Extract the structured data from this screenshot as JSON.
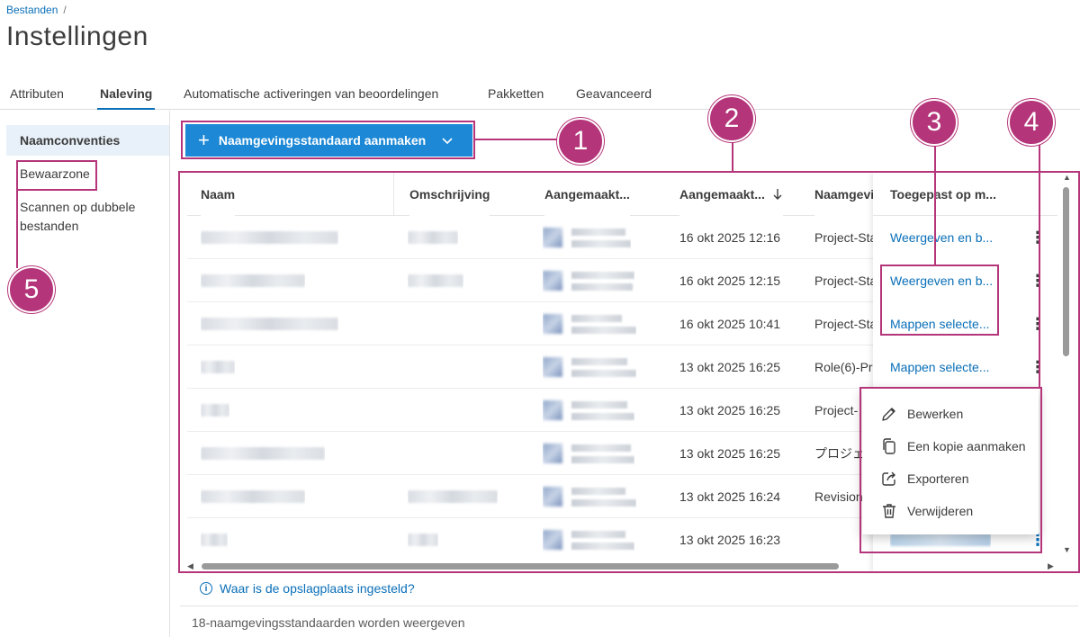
{
  "breadcrumb": {
    "root": "Bestanden",
    "separator": "/"
  },
  "page_title": "Instellingen",
  "tabs": [
    {
      "label": "Attributen",
      "active": false
    },
    {
      "label": "Naleving",
      "active": true
    },
    {
      "label": "Automatische activeringen van beoordelingen",
      "active": false
    },
    {
      "label": "Pakketten",
      "active": false
    },
    {
      "label": "Geavanceerd",
      "active": false
    }
  ],
  "sidebar": {
    "items": [
      {
        "label": "Naamconventies"
      },
      {
        "label": "Bewaarzone"
      },
      {
        "label": "Scannen op dubbele bestanden"
      }
    ]
  },
  "create_button": {
    "label": "Naamgevingsstandaard aanmaken",
    "icon": "plus-icon"
  },
  "table": {
    "columns": [
      "Naam",
      "Omschrijving",
      "Aangemaakt...",
      "Aangemaakt...",
      "Naamgevi",
      "Toegepast op m..."
    ],
    "sort_icon": "arrow-down-icon",
    "rows": [
      {
        "date": "16 okt 2025 12:16",
        "standard": "Project-Sta",
        "applied": "Weergeven en b..."
      },
      {
        "date": "16 okt 2025 12:15",
        "standard": "Project-Sta",
        "applied": "Weergeven en b..."
      },
      {
        "date": "16 okt 2025 10:41",
        "standard": "Project-Sta",
        "applied": "Mappen selecte..."
      },
      {
        "date": "13 okt 2025 16:25",
        "standard": "Role(6)-Pr",
        "applied": "Mappen selecte..."
      },
      {
        "date": "13 okt 2025 16:25",
        "standard": "Project-",
        "applied": ""
      },
      {
        "date": "13 okt 2025 16:25",
        "standard": "プロジェ",
        "applied": ""
      },
      {
        "date": "13 okt 2025 16:24",
        "standard": "Revision",
        "applied": ""
      },
      {
        "date": "13 okt 2025 16:23",
        "standard": "",
        "applied": ""
      }
    ]
  },
  "context_menu": {
    "items": [
      {
        "label": "Bewerken",
        "icon": "pencil-icon"
      },
      {
        "label": "Een kopie aanmaken",
        "icon": "copy-icon"
      },
      {
        "label": "Exporteren",
        "icon": "export-icon"
      },
      {
        "label": "Verwijderen",
        "icon": "trash-icon"
      }
    ]
  },
  "annotations": [
    "1",
    "2",
    "3",
    "4",
    "5"
  ],
  "storage_link": "Waar is de opslagplaats ingesteld?",
  "footer": "18-naamgevingsstandaarden worden weergeven",
  "colors": {
    "accent": "#1c88d6",
    "link": "#0a6fb8",
    "annotation": "#b5357a"
  }
}
